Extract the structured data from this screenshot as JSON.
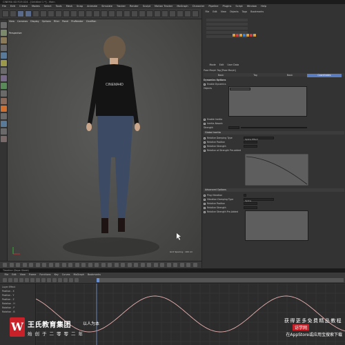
{
  "app": {
    "title": "CINEMA 4D R19.024 - [Untitled 1 *] - Main"
  },
  "menubar": {
    "items": [
      "File",
      "Edit",
      "Create",
      "Modes",
      "Select",
      "Tools",
      "Mesh",
      "Snap",
      "Animate",
      "Simulate",
      "Tracker",
      "Render",
      "Sculpt",
      "Motion Tracker",
      "MoGraph",
      "Character",
      "Pipeline",
      "Plugins",
      "Script",
      "Window",
      "Help"
    ]
  },
  "viewport": {
    "menu": [
      "View",
      "Cameras",
      "Display",
      "Options",
      "Filter",
      "Panel",
      "ProRender",
      "CineMan"
    ],
    "label": "Perspective",
    "status": "Grid Spacing : 100 cm",
    "shirt_text": "CINEMA4D"
  },
  "objects_panel": {
    "menu": [
      "File",
      "Edit",
      "View",
      "Objects",
      "Tags",
      "Bookmarks"
    ]
  },
  "attributes_panel": {
    "menu": [
      "Mode",
      "Edit",
      "User Data"
    ],
    "object_label": "Pose Morph Tag [Pose Morph]",
    "tabs": [
      "Basic",
      "Tag",
      "Basic",
      "Coordinates"
    ],
    "section_title": "Dynamics Options",
    "rows": [
      "Enable Dynamics",
      "Objects",
      "Enable Inertia",
      "Inertia Absorb",
      "Strength",
      "Global Inertia",
      "Relative Damping Type",
      "Relative Position",
      "Relative Strength",
      "Relative at Strength Pre-added"
    ],
    "section2_title": "Advanced Options",
    "rows2": [
      "Ping Vibration",
      "Vibration Damping Type",
      "Relative Position",
      "Relative Strength",
      "Relative Strength Pre-Added"
    ],
    "field_values": {
      "strength": "100 %",
      "damping_type": "Spline Effect",
      "vibration_damping": "Spline"
    }
  },
  "timeline": {
    "window_title": "Timeline (Dope Sheet)",
    "menu": [
      "File",
      "Edit",
      "View",
      "Frame",
      "Functions",
      "Key",
      "Curves",
      "MoGraph",
      "Bookmarks"
    ],
    "tracks": [
      "Layer Effect",
      "Position . X",
      "Position . Y",
      "Position . Z",
      "Rotation . H",
      "Rotation . P",
      "Rotation . B"
    ],
    "curve_color": "#e8b0b0"
  },
  "branding": {
    "logo_letter": "W",
    "name": "王氏教育集团",
    "motto": "以人为本",
    "slogan": "始创于二零零二年",
    "promo_line1": "获得更多免费精品教程",
    "promo_badge": "访学网",
    "promo_line3": "在AppStore或应用宝搜索下载"
  },
  "colors": {
    "accent_red": "#c8212a",
    "viewport_bg": "#4d4d4b"
  }
}
